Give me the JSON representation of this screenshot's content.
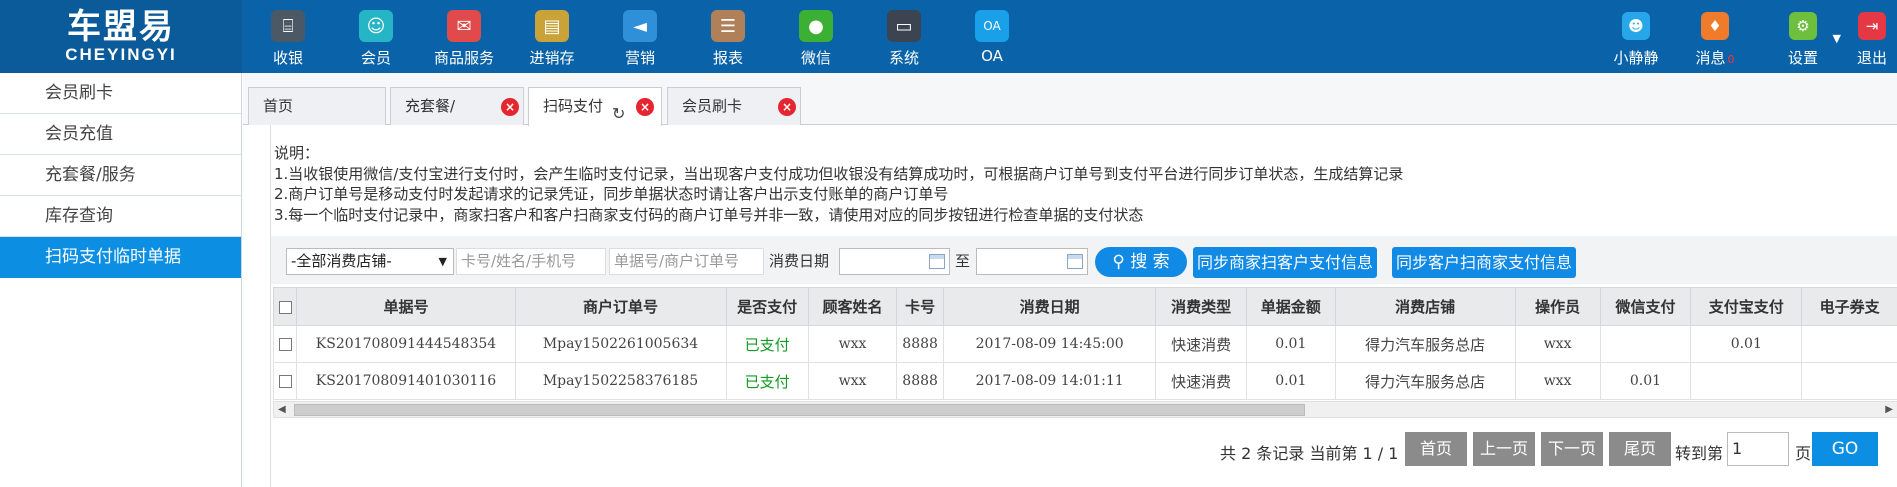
{
  "brand": {
    "cn": "车盟易",
    "en": "CHEYINGYI"
  },
  "nav": [
    {
      "label": "收银",
      "icon": "cash-register-icon",
      "color": "#4b5967"
    },
    {
      "label": "会员",
      "icon": "member-icon",
      "color": "#26b5c6"
    },
    {
      "label": "商品服务",
      "icon": "product-icon",
      "color": "#e04a4a"
    },
    {
      "label": "进销存",
      "icon": "inventory-icon",
      "color": "#c9a23a"
    },
    {
      "label": "营销",
      "icon": "megaphone-icon",
      "color": "#2f8fd8"
    },
    {
      "label": "报表",
      "icon": "report-icon",
      "color": "#b08058"
    },
    {
      "label": "微信",
      "icon": "wechat-icon",
      "color": "#3cb034"
    },
    {
      "label": "系统",
      "icon": "monitor-icon",
      "color": "#3b4450"
    },
    {
      "label": "OA",
      "icon": "oa-icon",
      "color": "#1aa0e8"
    }
  ],
  "right_nav": {
    "user": {
      "label": "小静静",
      "icon": "user-icon",
      "color": "#27a7ea"
    },
    "messages": {
      "label": "消息",
      "count": "0",
      "icon": "bell-icon",
      "color": "#f07b2a"
    },
    "settings": {
      "label": "设置",
      "icon": "gear-icon",
      "color": "#6fbf3e"
    },
    "logout": {
      "label": "退出",
      "icon": "logout-icon",
      "color": "#e53845"
    }
  },
  "sidebar": [
    {
      "label": "会员刷卡",
      "active": false
    },
    {
      "label": "会员充值",
      "active": false
    },
    {
      "label": "充套餐/服务",
      "active": false
    },
    {
      "label": "库存查询",
      "active": false
    },
    {
      "label": "扫码支付临时单据",
      "active": true
    }
  ],
  "tabs": [
    {
      "label": "首页",
      "closable": false,
      "active": false
    },
    {
      "label": "充套餐/",
      "closable": true,
      "active": false
    },
    {
      "label": "扫码支付",
      "closable": true,
      "active": true,
      "refresh": true
    },
    {
      "label": "会员刷卡",
      "closable": true,
      "active": false
    }
  ],
  "description": {
    "title": "说明：",
    "lines": [
      "1.当收银使用微信/支付宝进行支付时，会产生临时支付记录，当出现客户支付成功但收银没有结算成功时，可根据商户订单号到支付平台进行同步订单状态，生成结算记录",
      "2.商户订单号是移动支付时发起请求的记录凭证，同步单据状态时请让客户出示支付账单的商户订单号",
      "3.每一个临时支付记录中，商家扫客户和客户扫商家支付码的商户订单号并非一致，请使用对应的同步按钮进行检查单据的支付状态"
    ]
  },
  "filter": {
    "store_select": "-全部消费店铺-",
    "card_placeholder": "卡号/姓名/手机号",
    "order_placeholder": "单据号/商户订单号",
    "date_label": "消费日期",
    "to_label": "至",
    "search_label": "搜 索",
    "sync_merchant_label": "同步商家扫客户支付信息",
    "sync_customer_label": "同步客户扫商家支付信息"
  },
  "table": {
    "columns": [
      "单据号",
      "商户订单号",
      "是否支付",
      "顾客姓名",
      "卡号",
      "消费日期",
      "消费类型",
      "单据金额",
      "消费店铺",
      "操作员",
      "微信支付",
      "支付宝支付",
      "电子券支"
    ],
    "rows": [
      [
        "KS201708091444548354",
        "Mpay1502261005634",
        "已支付",
        "wxx",
        "8888",
        "2017-08-09 14:45:00",
        "快速消费",
        "0.01",
        "得力汽车服务总店",
        "wxx",
        "",
        "0.01",
        ""
      ],
      [
        "KS201708091401030116",
        "Mpay1502258376185",
        "已支付",
        "wxx",
        "8888",
        "2017-08-09 14:01:11",
        "快速消费",
        "0.01",
        "得力汽车服务总店",
        "wxx",
        "0.01",
        "",
        ""
      ]
    ]
  },
  "pager": {
    "info": "共 2 条记录 当前第 1 / 1",
    "first": "首页",
    "prev": "上一页",
    "next": "下一页",
    "last": "尾页",
    "goto_label": "转到第",
    "goto_value": "1",
    "page_label": "页",
    "go": "GO"
  }
}
